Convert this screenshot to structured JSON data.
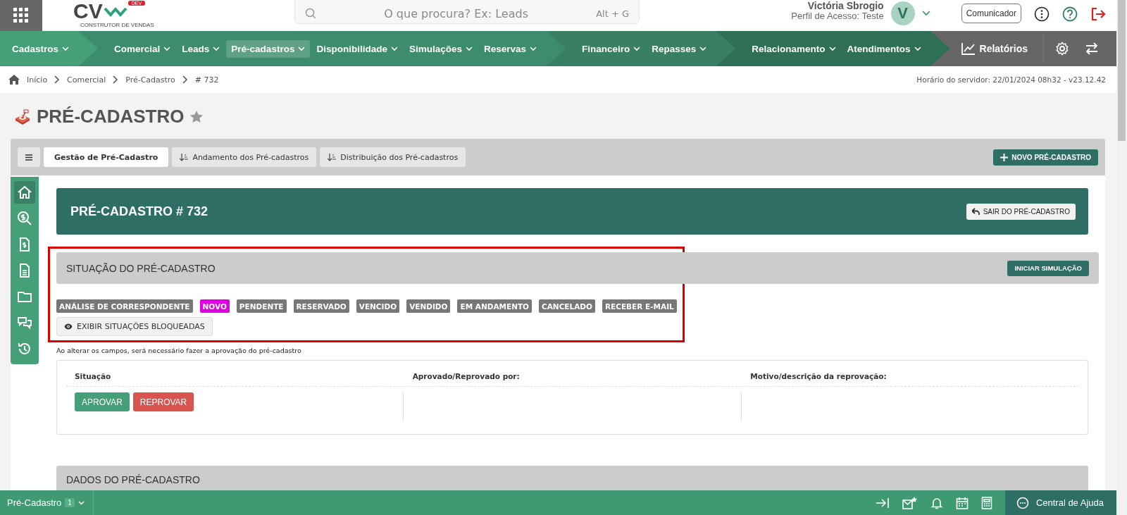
{
  "topbar": {
    "logo": {
      "letters": "CV",
      "tag": "DEV",
      "tagline": "CONSTRUTOR DE VENDAS"
    },
    "search": {
      "placeholder": "O que procura? Ex: Leads",
      "shortcut": "Alt + G"
    },
    "user": {
      "name": "Victória Sbrogio",
      "profile": "Perfil de Acesso: Teste",
      "initial": "V"
    },
    "communicator": "Comunicador"
  },
  "nav": {
    "groups": [
      {
        "color": "#45a07a",
        "items": [
          {
            "label": "Cadastros",
            "selected": false
          }
        ]
      },
      {
        "color": "#3d8c6b",
        "items": [
          {
            "label": "Comercial",
            "selected": false
          },
          {
            "label": "Leads",
            "selected": false
          },
          {
            "label": "Pré-cadastros",
            "selected": true
          },
          {
            "label": "Disponibilidade",
            "selected": false
          },
          {
            "label": "Simulações",
            "selected": false
          },
          {
            "label": "Reservas",
            "selected": false
          }
        ]
      },
      {
        "color": "#388061",
        "items": [
          {
            "label": "Financeiro",
            "selected": false
          },
          {
            "label": "Repasses",
            "selected": false
          }
        ]
      },
      {
        "color": "#2f7055",
        "items": [
          {
            "label": "Relacionamento",
            "selected": false
          },
          {
            "label": "Atendimentos",
            "selected": false
          }
        ]
      }
    ],
    "reports": "Relatórios"
  },
  "breadcrumb": [
    "Início",
    "Comercial",
    "Pré-Cadastro",
    "# 732"
  ],
  "server_time": "Horário do servidor: 22/01/2024 08h32 - v23.12.42",
  "page_title": "PRÉ-CADASTRO",
  "tabs": [
    {
      "label": "Gestão de Pré-Cadastro",
      "selected": true,
      "kind": "plain"
    },
    {
      "label": "Andamento dos Pré-cadastros",
      "selected": false,
      "kind": "sorted"
    },
    {
      "label": "Distribuição dos Pré-cadastros",
      "selected": false,
      "kind": "sorted"
    }
  ],
  "new_button": "NOVO PRÉ-CADASTRO",
  "sidebar": [
    {
      "kind": "home",
      "selected": true
    },
    {
      "kind": "search-dollar",
      "selected": false
    },
    {
      "kind": "invoice",
      "selected": false
    },
    {
      "kind": "file",
      "selected": false
    },
    {
      "kind": "folder",
      "selected": false
    },
    {
      "kind": "chat",
      "selected": false
    },
    {
      "kind": "history",
      "selected": false
    }
  ],
  "record": {
    "title": "PRÉ-CADASTRO # 732",
    "exit_button": "SAIR DO PRÉ-CADASTRO"
  },
  "status_section": {
    "title": "SITUAÇÃO DO PRÉ-CADASTRO",
    "highlighted": true,
    "action": "INICIAR SIMULAÇÃO",
    "statuses": [
      {
        "label": "ANÁLISE DE CORRESPONDENTE",
        "color": "#777777"
      },
      {
        "label": "NOVO",
        "color": "#e000e0"
      },
      {
        "label": "PENDENTE",
        "color": "#777777"
      },
      {
        "label": "RESERVADO",
        "color": "#777777"
      },
      {
        "label": "VENCIDO",
        "color": "#777777"
      },
      {
        "label": "VENDIDO",
        "color": "#777777"
      },
      {
        "label": "EM ANDAMENTO",
        "color": "#777777"
      },
      {
        "label": "CANCELADO",
        "color": "#777777"
      },
      {
        "label": "RECEBER E-MAIL",
        "color": "#777777"
      }
    ],
    "show_blocked": "EXIBIR SITUAÇÕES BLOQUEADAS"
  },
  "note": "Ao alterar os campos, será necessário fazer a aprovação do pré-cadastro",
  "approval": {
    "columns": [
      "Situação",
      "Aprovado/Reprovado por:",
      "Motivo/descrição da reprovação:"
    ],
    "approve": "APROVAR",
    "reject": "REPROVAR"
  },
  "next_section": "DADOS DO PRÉ-CADASTRO",
  "footer": {
    "tab": "Pré-Cadastro",
    "count": "1",
    "help": "Central de Ajuda"
  }
}
